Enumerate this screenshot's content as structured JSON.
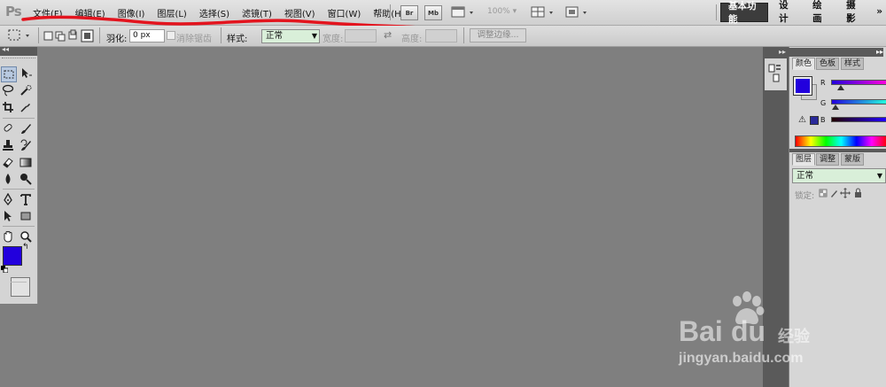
{
  "app": {
    "logo": "Ps"
  },
  "menu": [
    "文件(F)",
    "编辑(E)",
    "图像(I)",
    "图层(L)",
    "选择(S)",
    "滤镜(T)",
    "视图(V)",
    "窗口(W)",
    "帮助(H)"
  ],
  "toolbar": {
    "bridge": "Br",
    "minibridge": "Mb",
    "zoom": "100%"
  },
  "workspaces": [
    "基本功能",
    "设计",
    "绘画",
    "摄影"
  ],
  "options": {
    "feather_label": "羽化:",
    "feather_value": "0 px",
    "antialias_label": "消除锯齿",
    "style_label": "样式:",
    "style_value": "正常",
    "width_label": "宽度:",
    "height_label": "高度:",
    "refine_label": "调整边缘..."
  },
  "color_panel": {
    "tabs": [
      "颜色",
      "色板",
      "样式"
    ],
    "channels": [
      "R",
      "G",
      "B"
    ],
    "foreground": "#2200dd"
  },
  "layers_panel": {
    "tabs": [
      "图层",
      "调整",
      "蒙版"
    ],
    "blend_mode": "正常",
    "lock_label": "锁定:"
  },
  "colors": {
    "annotation": "#e3141e",
    "workspace_active": "#3c3c3c"
  },
  "watermark": {
    "brand_latin": "Bai",
    "brand_latin_2": "du",
    "brand_cn": "经验",
    "url": "jingyan.baidu.com"
  }
}
